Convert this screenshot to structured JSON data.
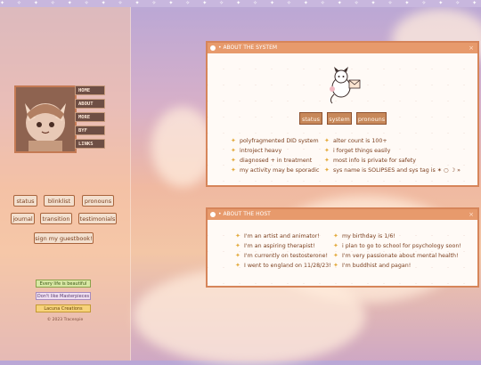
{
  "top_strip": "✦ ✧ ✦ ✧ ✦ ✧ ✦ ✧ ✦ ✧ ✦ ✧ ✦ ✧ ✦ ✧ ✦ ✧ ✦ ✧ ✦ ✧ ✦ ✧ ✦ ✧ ✦ ✧ ✦ ✧ ✦ ✧ ✦ ✧ ✦",
  "sidebar": {
    "nav": [
      "HOME",
      "ABOUT",
      "MORE",
      "BYF",
      "LINKS"
    ],
    "pills": [
      "status",
      "blinklist",
      "pronouns",
      "journal",
      "transition",
      "testimonials",
      "sign my guestbook!"
    ],
    "badges": [
      "Every life is beautiful",
      "Don't like Masterpieces",
      "Lacuna Creations"
    ],
    "copyright": "© 2023 Tracenpie"
  },
  "panel1": {
    "title": "• ABOUT THE SYSTEM",
    "close": "×",
    "buttons": [
      "status",
      "system",
      "pronouns"
    ],
    "left_facts": [
      "polyfragmented DID system",
      "introject heavy",
      "diagnosed + in treatment",
      "my activity may be sporadic"
    ],
    "right_facts": [
      "alter count is 100+",
      "i forget things easily",
      "most info is private for safety",
      "sys name is SOLIPSES and sys tag is ✶ ○ ☽ »"
    ]
  },
  "panel2": {
    "title": "• ABOUT THE HOST",
    "close": "×",
    "left_facts": [
      "I'm an artist and animator!",
      "I'm an aspiring therapist!",
      "I'm currently on testosterone!",
      "I went to england on 11/28/23!"
    ],
    "right_facts": [
      "my birthday is 1/6!",
      "i plan to go to school for psychology soon!",
      "I'm very passionate about mental health!",
      "I'm buddhist and pagan!"
    ]
  },
  "colors": {
    "accent": "#e79a6c",
    "brown": "#7b3f1e",
    "button": "#c7885a"
  }
}
